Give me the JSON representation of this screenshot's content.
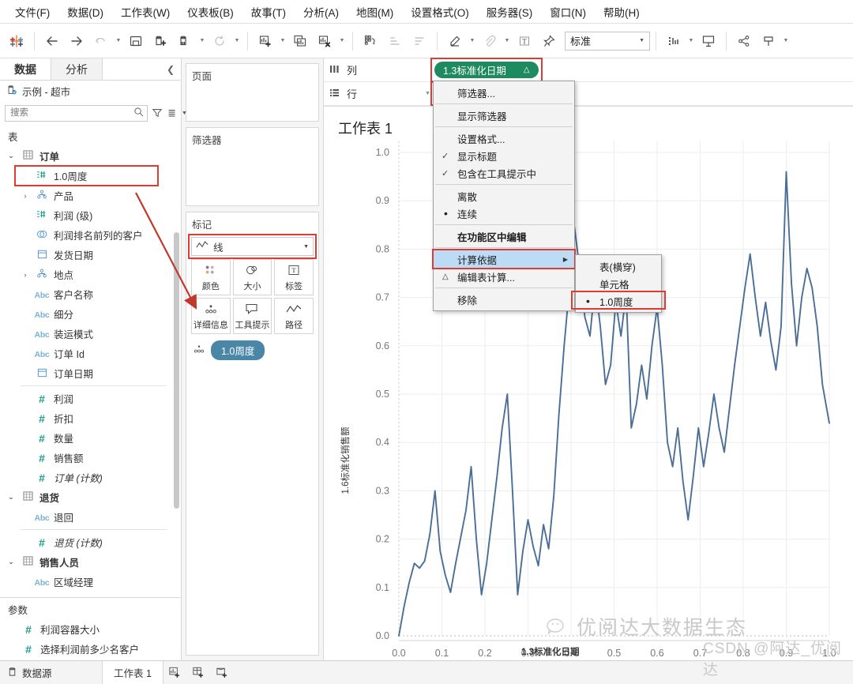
{
  "menubar": [
    {
      "label": "文件(F)"
    },
    {
      "label": "数据(D)"
    },
    {
      "label": "工作表(W)"
    },
    {
      "label": "仪表板(B)"
    },
    {
      "label": "故事(T)"
    },
    {
      "label": "分析(A)"
    },
    {
      "label": "地图(M)"
    },
    {
      "label": "设置格式(O)"
    },
    {
      "label": "服务器(S)"
    },
    {
      "label": "窗口(N)"
    },
    {
      "label": "帮助(H)"
    }
  ],
  "toolbar": {
    "fit_value": "标准",
    "icons": [
      "tableau-logo-icon",
      "back-arrow-icon",
      "forward-arrow-icon",
      "undo-icon",
      "save-icon",
      "new-data-source-icon",
      "pause-refresh-icon",
      "refresh-icon",
      "new-worksheet-icon",
      "duplicate-sheet-icon",
      "clear-sheet-icon",
      "swap-rows-cols-icon",
      "sort-ascending-icon",
      "sort-descending-icon",
      "highlighter-icon",
      "attach-icon",
      "text-tool-icon",
      "pin-icon",
      "show-me-icon",
      "presentation-mode-icon",
      "share-icon",
      "device-preview-icon"
    ]
  },
  "datapane": {
    "tab_data": "数据",
    "tab_analytics": "分析",
    "datasource": "示例 - 超市",
    "search_placeholder": "搜索",
    "tables_header": "表",
    "fields": [
      {
        "label": "订单",
        "kind": "table",
        "expandable": true,
        "expanded": true,
        "icon": "table-icon"
      },
      {
        "label": "1.0周度",
        "kind": "bin",
        "indent": true,
        "icon": "bin-icon",
        "highlight": true
      },
      {
        "label": "产品",
        "kind": "hierarchy",
        "indent": true,
        "expandable": true,
        "icon": "hierarchy-icon"
      },
      {
        "label": "利润 (级)",
        "kind": "bin",
        "indent": true,
        "icon": "histogram-icon"
      },
      {
        "label": "利润排名前列的客户",
        "kind": "set",
        "indent": true,
        "icon": "set-icon"
      },
      {
        "label": "发货日期",
        "kind": "date",
        "indent": true,
        "icon": "calendar-icon"
      },
      {
        "label": "地点",
        "kind": "hierarchy",
        "indent": true,
        "expandable": true,
        "icon": "hierarchy-icon"
      },
      {
        "label": "客户名称",
        "kind": "string",
        "indent": true,
        "icon": "abc-icon"
      },
      {
        "label": "细分",
        "kind": "string",
        "indent": true,
        "icon": "abc-icon"
      },
      {
        "label": "装运模式",
        "kind": "string",
        "indent": true,
        "icon": "abc-icon"
      },
      {
        "label": "订单 Id",
        "kind": "string",
        "indent": true,
        "icon": "abc-icon"
      },
      {
        "label": "订单日期",
        "kind": "date",
        "indent": true,
        "icon": "calendar-icon"
      },
      {
        "label": "__divider__",
        "kind": "divider"
      },
      {
        "label": "利润",
        "kind": "measure",
        "indent": true,
        "icon": "number-icon"
      },
      {
        "label": "折扣",
        "kind": "measure",
        "indent": true,
        "icon": "number-icon"
      },
      {
        "label": "数量",
        "kind": "measure",
        "indent": true,
        "icon": "number-icon"
      },
      {
        "label": "销售额",
        "kind": "measure",
        "indent": true,
        "icon": "number-icon"
      },
      {
        "label": "订单 (计数)",
        "kind": "measure",
        "indent": true,
        "icon": "number-icon",
        "italic": true
      },
      {
        "label": "退货",
        "kind": "table",
        "expandable": true,
        "expanded": true,
        "icon": "table-icon"
      },
      {
        "label": "退回",
        "kind": "string",
        "indent": true,
        "icon": "abc-icon"
      },
      {
        "label": "__divider__",
        "kind": "divider"
      },
      {
        "label": "退货 (计数)",
        "kind": "measure",
        "indent": true,
        "icon": "number-icon",
        "italic": true
      },
      {
        "label": "销售人员",
        "kind": "table",
        "expandable": true,
        "expanded": true,
        "icon": "table-icon"
      },
      {
        "label": "区域经理",
        "kind": "string",
        "indent": true,
        "icon": "abc-icon"
      }
    ],
    "params_header": "参数",
    "params": [
      {
        "label": "利润容器大小",
        "icon": "number-icon"
      },
      {
        "label": "选择利润前多少名客户",
        "icon": "number-icon"
      }
    ]
  },
  "shelfcol": {
    "pages_title": "页面",
    "filters_title": "筛选器",
    "marks_title": "标记",
    "marktype_value": "线",
    "mark_buttons": [
      {
        "label": "颜色",
        "icon": "color-icon"
      },
      {
        "label": "大小",
        "icon": "size-icon"
      },
      {
        "label": "标签",
        "icon": "label-icon"
      },
      {
        "label": "详细信息",
        "icon": "detail-icon"
      },
      {
        "label": "工具提示",
        "icon": "tooltip-icon"
      },
      {
        "label": "路径",
        "icon": "path-icon"
      }
    ],
    "mark_pill": "1.0周度"
  },
  "shelves": {
    "columns_label": "列",
    "rows_label": "行",
    "columns_pill": "1.3标准化日期",
    "rows_pill": "1.6标准化销售额"
  },
  "contextmenu": {
    "items": [
      {
        "label": "筛选器...",
        "type": "item"
      },
      {
        "type": "sep"
      },
      {
        "label": "显示筛选器",
        "type": "item"
      },
      {
        "type": "sep"
      },
      {
        "label": "设置格式...",
        "type": "item"
      },
      {
        "label": "显示标题",
        "type": "item",
        "checked": true
      },
      {
        "label": "包含在工具提示中",
        "type": "item",
        "checked": true
      },
      {
        "type": "sep"
      },
      {
        "label": "离散",
        "type": "item"
      },
      {
        "label": "连续",
        "type": "item",
        "radio": true
      },
      {
        "type": "sep"
      },
      {
        "label": "在功能区中编辑",
        "type": "item",
        "bold": true
      },
      {
        "type": "sep"
      },
      {
        "label": "计算依据",
        "type": "item",
        "submenu": true,
        "highlighted": true
      },
      {
        "label": "编辑表计算...",
        "type": "item",
        "delta": true
      },
      {
        "type": "sep"
      },
      {
        "label": "移除",
        "type": "item"
      }
    ],
    "submenu": [
      {
        "label": "表(横穿)"
      },
      {
        "label": "单元格"
      },
      {
        "label": "1.0周度",
        "radio": true,
        "highlight": true
      }
    ]
  },
  "worksheet": {
    "title": "工作表 1",
    "statusbar_datasource": "数据源",
    "statusbar_tab": "工作表 1",
    "statusbar_icons": [
      "new-worksheet-icon",
      "new-dashboard-icon",
      "new-story-icon"
    ]
  },
  "watermark": {
    "line1": "优阅达大数据生态",
    "line2": "CSDN @阿达_优阅达"
  },
  "colors": {
    "pill_green": "#1e8a5f",
    "mark_pill_blue": "#4a86a8",
    "highlight_red": "#e03b33",
    "line_blue": "#4a6e96",
    "menu_highlight": "#bcdcf5"
  },
  "chart_data": {
    "type": "line",
    "title": "工作表 1",
    "xlabel": "1.3标准化日期",
    "ylabel": "1.6标准化销售额",
    "xlim": [
      0.0,
      1.0
    ],
    "ylim": [
      0.0,
      1.0
    ],
    "xticks": [
      0.0,
      0.1,
      0.2,
      0.3,
      0.4,
      0.5,
      0.6,
      0.7,
      0.8,
      0.9,
      1.0
    ],
    "yticks": [
      0.0,
      0.1,
      0.2,
      0.3,
      0.4,
      0.5,
      0.6,
      0.7,
      0.8,
      0.9,
      1.0
    ],
    "grid": true,
    "legend": "none",
    "series": [
      {
        "name": "1.6标准化销售额",
        "color": "#4a6e96",
        "x": [
          0.0,
          0.012,
          0.024,
          0.036,
          0.048,
          0.06,
          0.072,
          0.084,
          0.096,
          0.108,
          0.12,
          0.132,
          0.144,
          0.156,
          0.168,
          0.18,
          0.192,
          0.204,
          0.216,
          0.228,
          0.24,
          0.252,
          0.264,
          0.276,
          0.288,
          0.3,
          0.312,
          0.324,
          0.336,
          0.348,
          0.36,
          0.372,
          0.384,
          0.396,
          0.408,
          0.42,
          0.432,
          0.444,
          0.456,
          0.468,
          0.48,
          0.492,
          0.504,
          0.516,
          0.528,
          0.54,
          0.552,
          0.564,
          0.576,
          0.588,
          0.6,
          0.612,
          0.624,
          0.636,
          0.648,
          0.66,
          0.672,
          0.684,
          0.696,
          0.708,
          0.72,
          0.732,
          0.744,
          0.756,
          0.768,
          0.78,
          0.792,
          0.804,
          0.816,
          0.828,
          0.84,
          0.852,
          0.864,
          0.876,
          0.888,
          0.9,
          0.912,
          0.924,
          0.936,
          0.948,
          0.96,
          0.972,
          0.984,
          1.0
        ],
        "y": [
          0.0,
          0.06,
          0.11,
          0.15,
          0.14,
          0.155,
          0.21,
          0.3,
          0.175,
          0.125,
          0.09,
          0.15,
          0.205,
          0.26,
          0.35,
          0.2,
          0.085,
          0.15,
          0.24,
          0.33,
          0.43,
          0.5,
          0.3,
          0.085,
          0.175,
          0.24,
          0.185,
          0.145,
          0.23,
          0.18,
          0.29,
          0.46,
          0.6,
          0.72,
          0.845,
          0.76,
          0.66,
          0.62,
          0.73,
          0.64,
          0.52,
          0.56,
          0.69,
          0.62,
          0.71,
          0.43,
          0.48,
          0.56,
          0.49,
          0.6,
          0.68,
          0.56,
          0.4,
          0.35,
          0.43,
          0.32,
          0.24,
          0.33,
          0.43,
          0.35,
          0.42,
          0.5,
          0.43,
          0.38,
          0.47,
          0.56,
          0.64,
          0.72,
          0.79,
          0.7,
          0.62,
          0.69,
          0.61,
          0.55,
          0.64,
          0.96,
          0.73,
          0.6,
          0.7,
          0.76,
          0.72,
          0.64,
          0.52,
          0.44
        ]
      }
    ]
  }
}
